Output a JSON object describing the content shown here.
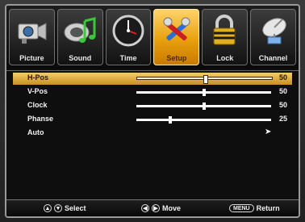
{
  "tabs": [
    {
      "label": "Picture",
      "icon": "camera-icon",
      "active": false
    },
    {
      "label": "Sound",
      "icon": "music-note-icon",
      "active": false
    },
    {
      "label": "Time",
      "icon": "clock-icon",
      "active": false
    },
    {
      "label": "Setup",
      "icon": "tools-icon",
      "active": true
    },
    {
      "label": "Lock",
      "icon": "lock-icon",
      "active": false
    },
    {
      "label": "Channel",
      "icon": "satellite-dish-icon",
      "active": false
    }
  ],
  "menu": {
    "selected_index": 0,
    "items": [
      {
        "label": "H-Pos",
        "value": "50",
        "level": 50
      },
      {
        "label": "V-Pos",
        "value": "50",
        "level": 50
      },
      {
        "label": "Clock",
        "value": "50",
        "level": 50
      },
      {
        "label": "Phanse",
        "value": "25",
        "level": 25
      },
      {
        "label": "Auto",
        "action": "➤"
      }
    ]
  },
  "footer": {
    "select": {
      "label": "Select",
      "icons": [
        "▲",
        "▼"
      ]
    },
    "move": {
      "label": "Move",
      "icons": [
        "◀",
        "▶"
      ]
    },
    "return": {
      "key": "MENU",
      "label": "Return"
    }
  },
  "colors": {
    "accent": "#e8a00d",
    "highlight": "#f4cc6c"
  }
}
